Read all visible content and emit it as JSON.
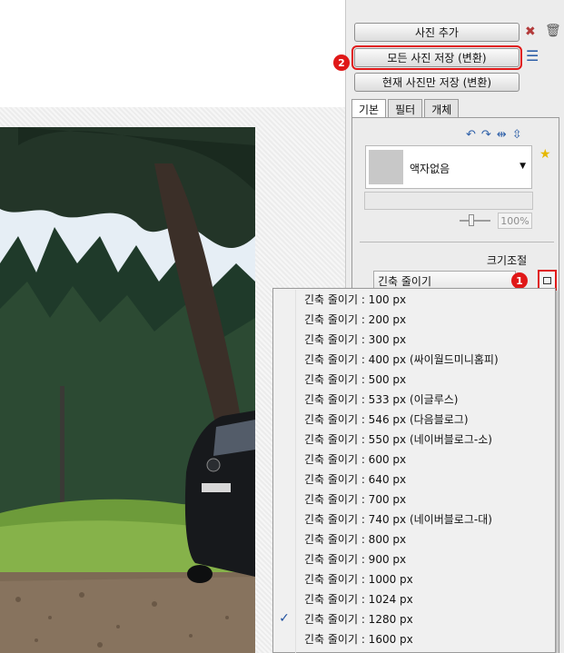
{
  "panel": {
    "add_photo": "사진 추가",
    "save_all": "모든 사진 저장 (변환)",
    "save_current": "현재 사진만 저장 (변환)",
    "badge_1": "1",
    "badge_2": "2",
    "tabs": [
      {
        "label": "기본",
        "active": true
      },
      {
        "label": "필터",
        "active": false
      },
      {
        "label": "개체",
        "active": false
      }
    ],
    "frame_value": "액자없음",
    "zoom_value": "100%",
    "resize_label": "크기조절",
    "resize_value": "긴축 줄이기"
  },
  "dropdown": {
    "selected_index": 16,
    "check_mark": "✓",
    "items": [
      "긴축 줄이기 : 100 px",
      "긴축 줄이기 : 200 px",
      "긴축 줄이기 : 300 px",
      "긴축 줄이기 : 400 px (싸이월드미니홈피)",
      "긴축 줄이기 : 500 px",
      "긴축 줄이기 : 533 px (이글루스)",
      "긴축 줄이기 : 546 px (다음블로그)",
      "긴축 줄이기 : 550 px (네이버블로그-소)",
      "긴축 줄이기 : 600 px",
      "긴축 줄이기 : 640 px",
      "긴축 줄이기 : 700 px",
      "긴축 줄이기 : 740 px (네이버블로그-대)",
      "긴축 줄이기 : 800 px",
      "긴축 줄이기 : 900 px",
      "긴축 줄이기 : 1000 px",
      "긴축 줄이기 : 1024 px",
      "긴축 줄이기 : 1280 px",
      "긴축 줄이기 : 1600 px"
    ]
  },
  "colors": {
    "highlight_red": "#e01818",
    "check_blue": "#1e4f9e"
  },
  "icons": [
    "delete-icon",
    "trash-icon",
    "list-icon",
    "rotate-left-icon",
    "rotate-right-icon",
    "flip-horizontal-icon",
    "flip-vertical-icon",
    "star-icon",
    "dropdown-arrow-icon",
    "resize-options-icon"
  ]
}
